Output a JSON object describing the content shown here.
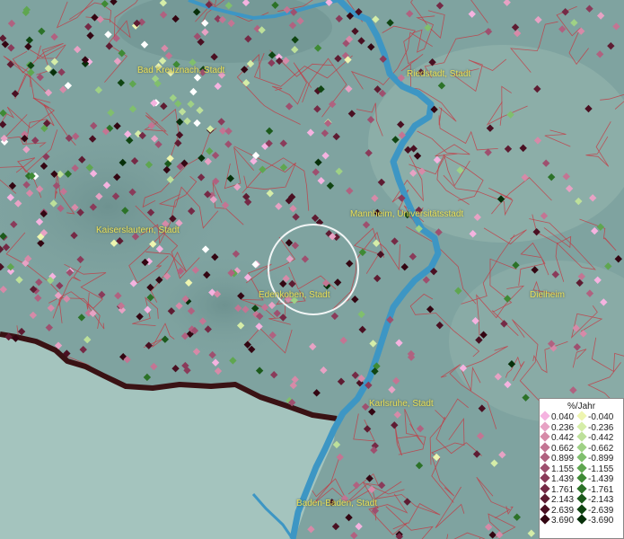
{
  "map": {
    "cities": [
      {
        "id": "bad-kreuznach",
        "label": "Bad Kreuznach, Stadt"
      },
      {
        "id": "riedstadt",
        "label": "Riedstadt, Stadt"
      },
      {
        "id": "mannheim",
        "label": "Mannheim, Universitätsstadt"
      },
      {
        "id": "kaiserslautern",
        "label": "Kaiserslautern, Stadt"
      },
      {
        "id": "edenkoben",
        "label": "Edenkoben, Stadt"
      },
      {
        "id": "dielheim",
        "label": "Dielheim"
      },
      {
        "id": "karlsruhe",
        "label": "Karlsruhe, Stadt"
      },
      {
        "id": "baden-baden",
        "label": "Baden-Baden, Stadt"
      }
    ],
    "colors": {
      "terrain": "#7fa3a0",
      "river": "#3d96c4",
      "boundaries": "#c8323c",
      "border": "#3a1214",
      "france": "#a4c4be"
    }
  },
  "legend": {
    "title": "%/Jahr",
    "rows": [
      {
        "pos": "0.040",
        "pos_color": "#f5b3e0",
        "neg": "-0.040",
        "neg_color": "#eef5b0"
      },
      {
        "pos": "0.236",
        "pos_color": "#e7a2c4",
        "neg": "-0.236",
        "neg_color": "#d5eda8"
      },
      {
        "pos": "0.442",
        "pos_color": "#d68aa8",
        "neg": "-0.442",
        "neg_color": "#bde09a"
      },
      {
        "pos": "0.662",
        "pos_color": "#c37593",
        "neg": "-0.662",
        "neg_color": "#9fd185"
      },
      {
        "pos": "0.899",
        "pos_color": "#b06280",
        "neg": "-0.899",
        "neg_color": "#80bf6d"
      },
      {
        "pos": "1.155",
        "pos_color": "#9e506f",
        "neg": "-1.155",
        "neg_color": "#5fa650"
      },
      {
        "pos": "1.439",
        "pos_color": "#8a3b5a",
        "neg": "-1.439",
        "neg_color": "#3f8a35"
      },
      {
        "pos": "1.761",
        "pos_color": "#752a46",
        "neg": "-1.761",
        "neg_color": "#2c7228"
      },
      {
        "pos": "2.143",
        "pos_color": "#5e1c32",
        "neg": "-2.143",
        "neg_color": "#1c5a1c"
      },
      {
        "pos": "2.639",
        "pos_color": "#4a1022",
        "neg": "-2.639",
        "neg_color": "#104512"
      },
      {
        "pos": "3.690",
        "pos_color": "#330612",
        "neg": "-3.690",
        "neg_color": "#07300a"
      }
    ]
  }
}
